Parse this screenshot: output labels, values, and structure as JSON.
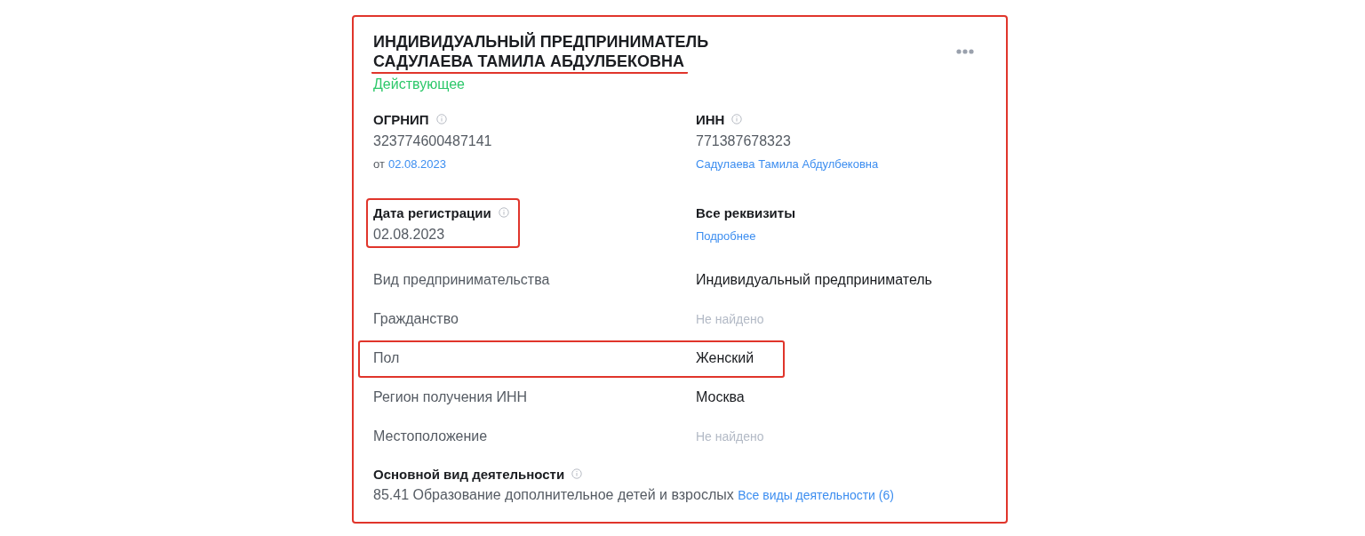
{
  "card": {
    "highlighted": true,
    "title": "ИНДИВИДУАЛЬНЫЙ ПРЕДПРИНИМАТЕЛЬ",
    "name": "САДУЛАЕВА ТАМИЛА АБДУЛБЕКОВНА",
    "name_underlined": true,
    "status": "Действующее",
    "blocks": [
      {
        "label": "ОГРНИП",
        "info": true,
        "value": "323774600487141",
        "note_prefix": "от",
        "note_link": "02.08.2023",
        "highlighted": false
      },
      {
        "label": "ИНН",
        "info": true,
        "value": "771387678323",
        "note_link": "Садулаева Тамила Абдулбековна",
        "highlighted": false
      },
      {
        "label": "Дата регистрации",
        "info": true,
        "value": "02.08.2023",
        "highlighted": true
      },
      {
        "label": "Все реквизиты",
        "info": false,
        "note_link": "Подробнее",
        "highlighted": false
      }
    ],
    "properties": [
      {
        "label": "Вид предпринимательства",
        "value": "Индивидуальный предприниматель",
        "found": true,
        "highlighted": false
      },
      {
        "label": "Гражданство",
        "value": "Не найдено",
        "found": false,
        "highlighted": false
      },
      {
        "label": "Пол",
        "value": "Женский",
        "found": true,
        "highlighted": true
      },
      {
        "label": "Регион получения ИНН",
        "value": "Москва",
        "found": true,
        "highlighted": false
      },
      {
        "label": "Местоположение",
        "value": "Не найдено",
        "found": false,
        "highlighted": false
      }
    ],
    "activity": {
      "label": "Основной вид деятельности",
      "info": true,
      "text": "85.41 Образование дополнительное детей и взрослых",
      "link": "Все виды деятельности (6)"
    }
  }
}
